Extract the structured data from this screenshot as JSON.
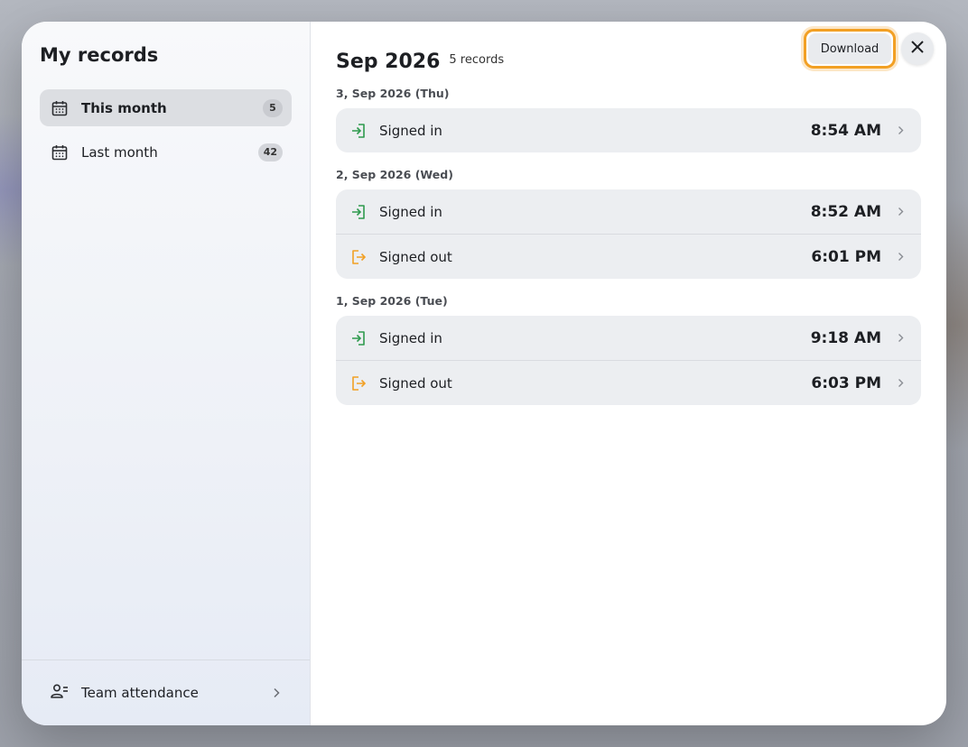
{
  "sidebar": {
    "title": "My records",
    "items": [
      {
        "label": "This month",
        "count": "5",
        "active": true
      },
      {
        "label": "Last month",
        "count": "42",
        "active": false
      }
    ],
    "footer_label": "Team attendance"
  },
  "header": {
    "title": "Sep 2026",
    "record_count": "5 records",
    "download_label": "Download"
  },
  "days": [
    {
      "label": "3, Sep 2026 (Thu)",
      "records": [
        {
          "type": "Signed in",
          "time": "8:54 AM",
          "kind": "in"
        }
      ]
    },
    {
      "label": "2, Sep 2026 (Wed)",
      "records": [
        {
          "type": "Signed in",
          "time": "8:52 AM",
          "kind": "in"
        },
        {
          "type": "Signed out",
          "time": "6:01 PM",
          "kind": "out"
        }
      ]
    },
    {
      "label": "1, Sep 2026 (Tue)",
      "records": [
        {
          "type": "Signed in",
          "time": "9:18 AM",
          "kind": "in"
        },
        {
          "type": "Signed out",
          "time": "6:03 PM",
          "kind": "out"
        }
      ]
    }
  ],
  "colors": {
    "signed_in": "#2e9a4e",
    "signed_out": "#f2a024",
    "focus_ring": "#f2a024"
  }
}
